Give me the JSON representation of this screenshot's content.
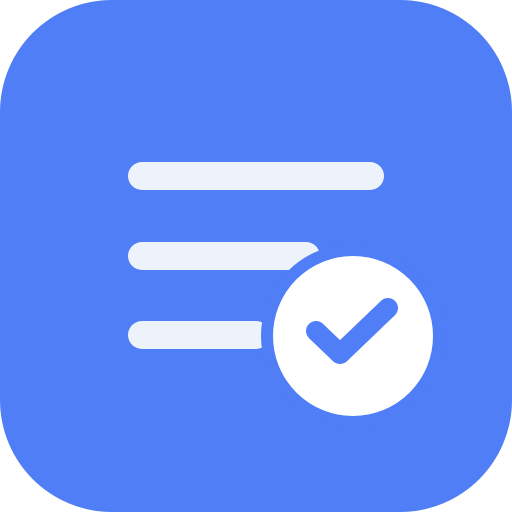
{
  "icon": {
    "name": "task-list-checked-icon",
    "colors": {
      "tile": "#4F7EF6",
      "lines": "#EEF2FB",
      "badge_fill": "#FFFFFF",
      "badge_ring": "#4F7EF6",
      "check": "#4F7EF6"
    }
  }
}
